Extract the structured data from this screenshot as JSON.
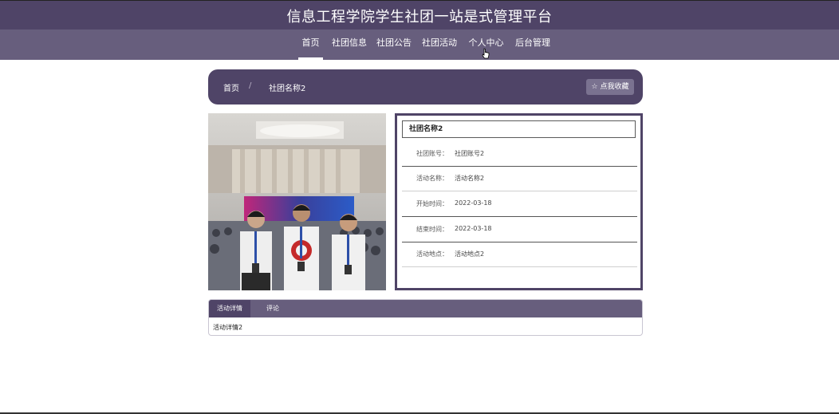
{
  "header": {
    "title": "信息工程学院学生社团一站是式管理平台"
  },
  "nav": {
    "items": [
      {
        "label": "首页",
        "active": true
      },
      {
        "label": "社团信息",
        "active": false
      },
      {
        "label": "社团公告",
        "active": false
      },
      {
        "label": "社团活动",
        "active": false
      },
      {
        "label": "个人中心",
        "active": false
      },
      {
        "label": "后台管理",
        "active": false
      }
    ]
  },
  "breadcrumb": {
    "home": "首页",
    "separator": "/",
    "current": "社团名称2"
  },
  "favorite_button": {
    "label": "☆ 点我收藏"
  },
  "info": {
    "title": "社团名称2",
    "rows": [
      {
        "label": "社团账号：",
        "value": "社团账号2"
      },
      {
        "label": "活动名称：",
        "value": "活动名称2"
      },
      {
        "label": "开始时间：",
        "value": "2022-03-18"
      },
      {
        "label": "结束时间：",
        "value": "2022-03-18"
      },
      {
        "label": "活动地点：",
        "value": "活动地点2"
      }
    ]
  },
  "tabs": {
    "items": [
      {
        "label": "活动详情",
        "active": true
      },
      {
        "label": "评论",
        "active": false
      }
    ],
    "content": "活动详情2"
  },
  "colors": {
    "primary": "#4f4467",
    "secondary": "#675e7d"
  }
}
